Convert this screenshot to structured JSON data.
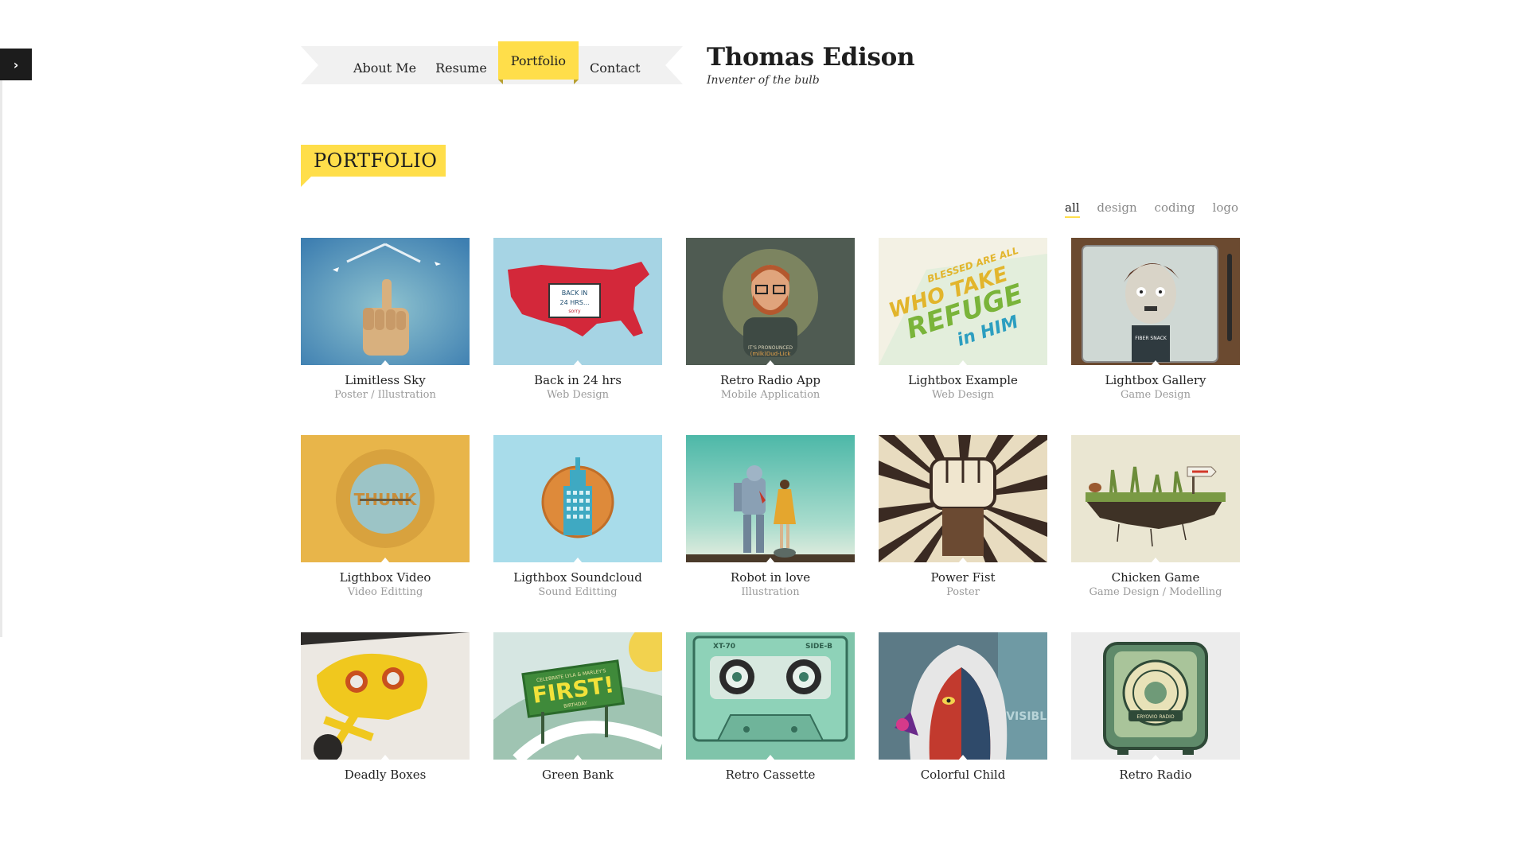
{
  "sidebar": {
    "toggle_icon": "chevron-right-icon"
  },
  "nav": {
    "items": [
      {
        "label": "About Me",
        "active": false
      },
      {
        "label": "Resume",
        "active": false
      },
      {
        "label": "Portfolio",
        "active": true
      },
      {
        "label": "Contact",
        "active": false
      }
    ]
  },
  "brand": {
    "name": "Thomas Edison",
    "tagline": "Inventer of the bulb"
  },
  "section": {
    "title": "PORTFOLIO"
  },
  "filters": [
    {
      "label": "all",
      "active": true
    },
    {
      "label": "design",
      "active": false
    },
    {
      "label": "coding",
      "active": false
    },
    {
      "label": "logo",
      "active": false
    }
  ],
  "portfolio": [
    {
      "title": "Limitless Sky",
      "category": "Poster / Illustration"
    },
    {
      "title": "Back in 24 hrs",
      "category": "Web Design"
    },
    {
      "title": "Retro Radio App",
      "category": "Mobile Application"
    },
    {
      "title": "Lightbox Example",
      "category": "Web Design"
    },
    {
      "title": "Lightbox Gallery",
      "category": "Game Design"
    },
    {
      "title": "Ligthbox Video",
      "category": "Video Editting"
    },
    {
      "title": "Ligthbox Soundcloud",
      "category": "Sound Editting"
    },
    {
      "title": "Robot in love",
      "category": "Illustration"
    },
    {
      "title": "Power Fist",
      "category": "Poster"
    },
    {
      "title": "Chicken Game",
      "category": "Game Design / Modelling"
    },
    {
      "title": "Deadly Boxes",
      "category": ""
    },
    {
      "title": "Green Bank",
      "category": ""
    },
    {
      "title": "Retro Cassette",
      "category": ""
    },
    {
      "title": "Colorful Child",
      "category": ""
    },
    {
      "title": "Retro Radio",
      "category": ""
    }
  ],
  "thumb_art": {
    "back_in_sign_lines": [
      "BACK IN",
      "24 HRS...",
      "sorry"
    ],
    "retro_radio_app_line1": "IT'S PRONOUNCED",
    "retro_radio_app_line2": "(milk)Dud-Lick",
    "lightbox_example_line1": "BLESSED ARE ALL",
    "lightbox_example_line2": "WHO TAKE",
    "lightbox_example_line3": "REFUGE",
    "lightbox_example_line4": "in HIM",
    "lightbox_gallery_shirt_text": "FIBER SNACK",
    "video_text": "THUNK",
    "green_bank_line1": "CELEBRATE LYLA & MARLEY'S",
    "green_bank_line2": "FIRST!",
    "green_bank_line3": "BIRTHDAY",
    "cassette_left": "XT-70",
    "cassette_right": "SIDE-B",
    "colorful_child_text": "INVISIBLE",
    "retro_radio_text": "ERYOVIO RADIO"
  }
}
